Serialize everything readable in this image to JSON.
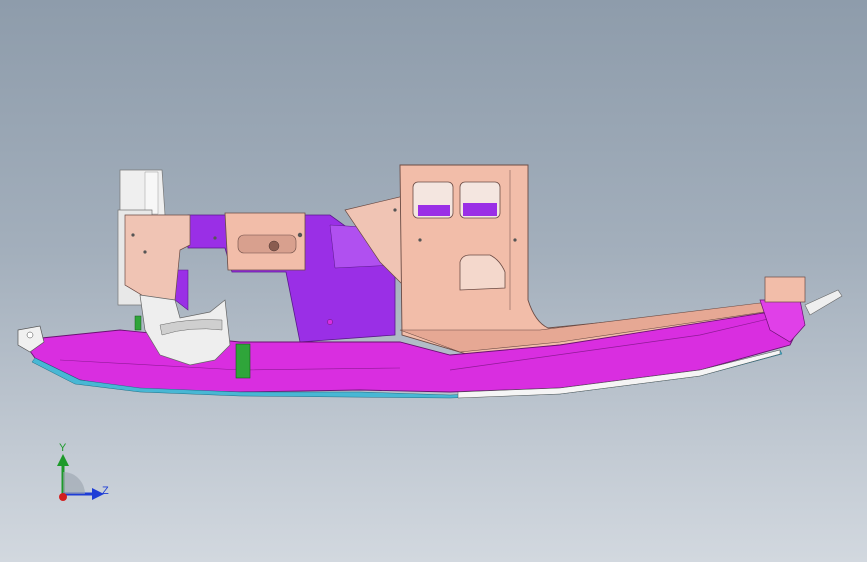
{
  "viewport": {
    "background_top": "#8e9cab",
    "background_bottom": "#d2d8df"
  },
  "model": {
    "colors": {
      "magenta": "#d92ee0",
      "purple": "#9a2fe6",
      "salmon": "#f0b8a8",
      "white_parts": "#eeeeee",
      "cyan_edge": "#48b7d4",
      "green_parts": "#2fa53a"
    }
  },
  "triad": {
    "y_label": "Y",
    "z_label": "Z",
    "icons": [
      "axis-triad-icon"
    ],
    "colors": {
      "y": "#1d9a2a",
      "z": "#1e3dd6",
      "x": "#d31f1f"
    }
  }
}
